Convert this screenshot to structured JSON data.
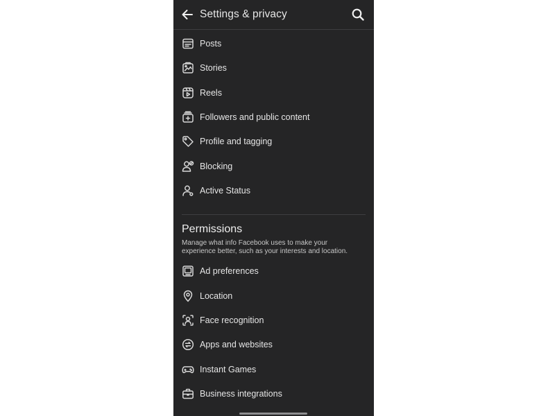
{
  "header": {
    "title": "Settings & privacy",
    "back_icon": "arrow-left-icon",
    "search_icon": "search-icon"
  },
  "audience_items": [
    {
      "label": "Posts",
      "icon": "posts-icon"
    },
    {
      "label": "Stories",
      "icon": "stories-icon"
    },
    {
      "label": "Reels",
      "icon": "reels-icon"
    },
    {
      "label": "Followers and public content",
      "icon": "followers-icon"
    },
    {
      "label": "Profile and tagging",
      "icon": "tag-icon"
    },
    {
      "label": "Blocking",
      "icon": "blocking-icon"
    },
    {
      "label": "Active Status",
      "icon": "active-status-icon"
    }
  ],
  "permissions": {
    "title": "Permissions",
    "description": "Manage what info Facebook uses to make your experience better, such as your interests and location.",
    "items": [
      {
        "label": "Ad preferences",
        "icon": "ad-preferences-icon"
      },
      {
        "label": "Location",
        "icon": "location-pin-icon"
      },
      {
        "label": "Face recognition",
        "icon": "face-recognition-icon"
      },
      {
        "label": "Apps and websites",
        "icon": "apps-websites-icon"
      },
      {
        "label": "Instant Games",
        "icon": "gamepad-icon"
      },
      {
        "label": "Business integrations",
        "icon": "briefcase-icon"
      }
    ]
  },
  "colors": {
    "background": "#252526",
    "text": "#e6e6e6",
    "divider": "#3e3e40"
  }
}
